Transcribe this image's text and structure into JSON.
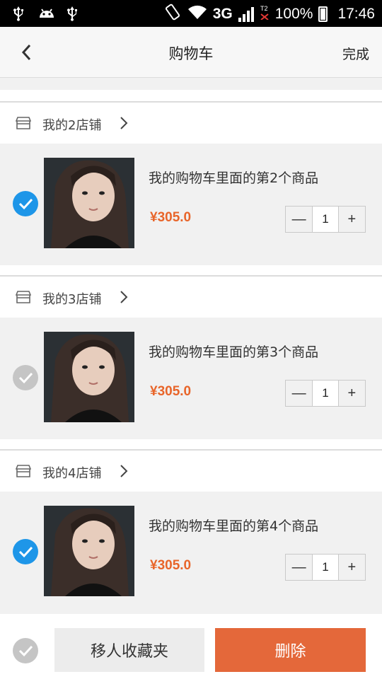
{
  "status_bar": {
    "network": "3G",
    "battery": "100%",
    "time": "17:46"
  },
  "header": {
    "title": "购物车",
    "done_label": "完成"
  },
  "shops": [
    {
      "name": "我的2店铺",
      "item": {
        "name": "我的购物车里面的第2个商品",
        "price": "¥305.0",
        "quantity": "1",
        "checked": true
      }
    },
    {
      "name": "我的3店铺",
      "item": {
        "name": "我的购物车里面的第3个商品",
        "price": "¥305.0",
        "quantity": "1",
        "checked": false
      }
    },
    {
      "name": "我的4店铺",
      "item": {
        "name": "我的购物车里面的第4个商品",
        "price": "¥305.0",
        "quantity": "1",
        "checked": true
      }
    }
  ],
  "stepper": {
    "minus": "—",
    "plus": "+"
  },
  "bottom": {
    "select_all_checked": false,
    "favorite_label": "移人收藏夹",
    "delete_label": "删除"
  },
  "colors": {
    "accent_blue": "#1e96e8",
    "price_orange": "#e8652a",
    "delete_orange": "#e4683a",
    "unchecked_gray": "#c5c5c5"
  }
}
